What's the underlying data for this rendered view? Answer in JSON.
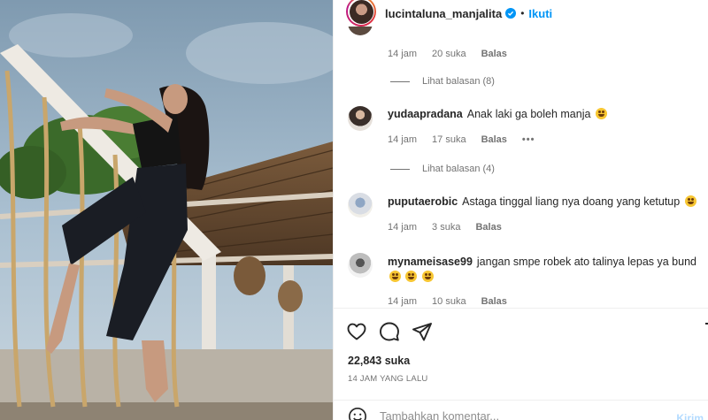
{
  "post": {
    "username": "lucintaluna_manjalita",
    "separator": "•",
    "follow_label": "Ikuti",
    "likes": "22,843 suka",
    "time_ago": "14 JAM YANG LALU",
    "comment_placeholder": "Tambahkan komentar...",
    "post_label": "Kirim"
  },
  "comments": [
    {
      "time": "14 jam",
      "likes": "20 suka",
      "reply": "Balas",
      "view_replies": "Lihat balasan (8)"
    },
    {
      "username": "yudaapradana",
      "text": "Anak laki ga boleh manja",
      "time": "14 jam",
      "likes": "17 suka",
      "reply": "Balas",
      "more": "•••",
      "view_replies": "Lihat balasan (4)"
    },
    {
      "username": "puputaerobic",
      "text": "Astaga tinggal liang nya doang yang ketutup",
      "time": "14 jam",
      "likes": "3 suka",
      "reply": "Balas"
    },
    {
      "username": "mynameisase99",
      "text": "jangan smpe robek ato talinya lepas ya bund",
      "time": "14 jam",
      "likes": "10 suka",
      "reply": "Balas"
    }
  ],
  "icons": {
    "like": "heart-icon",
    "comment": "comment-icon",
    "share": "share-icon",
    "emoji": "smile-icon",
    "verified": "verified-badge-icon"
  },
  "colors": {
    "accent": "#0095f6",
    "text": "#262626",
    "muted": "#737373",
    "divider": "#efefef"
  }
}
